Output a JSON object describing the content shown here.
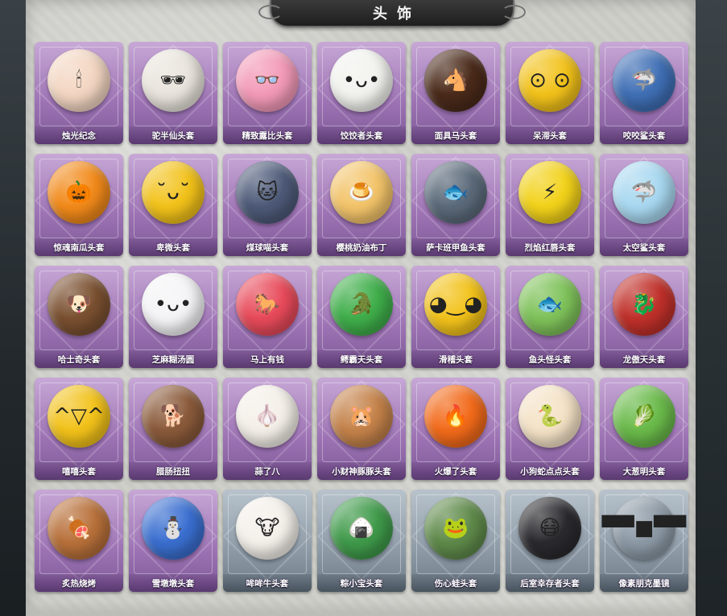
{
  "header": {
    "title": "头饰"
  },
  "items": [
    {
      "label": "烛光纪念",
      "color": "#f3d6c2",
      "glyph": "🕯"
    },
    {
      "label": "驼半仙头套",
      "color": "#e9e4dc",
      "glyph": "🕶"
    },
    {
      "label": "精致露比头套",
      "color": "#f39ab8",
      "glyph": "👓"
    },
    {
      "label": "饺饺者头套",
      "color": "#f2f2ee",
      "glyph": "•ᴗ•"
    },
    {
      "label": "面具马头套",
      "color": "#4a2a1a",
      "glyph": "🐴"
    },
    {
      "label": "呆滞头套",
      "color": "#f2c21a",
      "glyph": "⊙ ⊙"
    },
    {
      "label": "咬咬鲨头套",
      "color": "#3f6fb5",
      "glyph": "🦈"
    },
    {
      "label": "惊魂南瓜头套",
      "color": "#f28a1a",
      "glyph": "🎃"
    },
    {
      "label": "卑微头套",
      "color": "#f2c21a",
      "glyph": "˘ᴗ˘"
    },
    {
      "label": "煤球喵头套",
      "color": "#4d5a78",
      "glyph": "🐱"
    },
    {
      "label": "樱桃奶油布丁",
      "color": "#f3c46a",
      "glyph": "🍮"
    },
    {
      "label": "萨卡班甲鱼头套",
      "color": "#5b6a7a",
      "glyph": "🐟"
    },
    {
      "label": "烈焰红唇头套",
      "color": "#f2d21a",
      "glyph": "⚡"
    },
    {
      "label": "太空鲨头套",
      "color": "#a8d8f0",
      "glyph": "🦈"
    },
    {
      "label": "哈士奇头套",
      "color": "#7a5030",
      "glyph": "🐶"
    },
    {
      "label": "芝麻糊汤圆",
      "color": "#f4f4f6",
      "glyph": "•ᴗ•"
    },
    {
      "label": "马上有钱",
      "color": "#e84a5a",
      "glyph": "🐎"
    },
    {
      "label": "鳄霸天头套",
      "color": "#3fae4a",
      "glyph": "🐊"
    },
    {
      "label": "滑稽头套",
      "color": "#f2c21a",
      "glyph": "◕‿◕"
    },
    {
      "label": "鱼头怪头套",
      "color": "#7fc25a",
      "glyph": "🐟"
    },
    {
      "label": "龙傲天头套",
      "color": "#c0302a",
      "glyph": "🐉"
    },
    {
      "label": "嘻嘻头套",
      "color": "#f2c21a",
      "glyph": "^▽^"
    },
    {
      "label": "腊肠扭扭",
      "color": "#8a5a3a",
      "glyph": "🐕"
    },
    {
      "label": "蒜了八",
      "color": "#f4efe8",
      "glyph": "🧄"
    },
    {
      "label": "小财神豚豚头套",
      "color": "#c4824a",
      "glyph": "🐹"
    },
    {
      "label": "火爆了头套",
      "color": "#f26a1a",
      "glyph": "🔥"
    },
    {
      "label": "小狗蛇点点头套",
      "color": "#f4e2c6",
      "glyph": "🐍"
    },
    {
      "label": "大葱明头套",
      "color": "#6aba4a",
      "glyph": "🥬"
    },
    {
      "label": "炙热烧烤",
      "color": "#b8703a",
      "glyph": "🍖"
    },
    {
      "label": "雪墩墩头套",
      "color": "#3a6fd0",
      "glyph": "⛄"
    },
    {
      "label": "哞哞牛头套",
      "color": "#f4f0ea",
      "glyph": "🐮"
    },
    {
      "label": "粽小宝头套",
      "color": "#3f9a4a",
      "glyph": "🍙"
    },
    {
      "label": "伤心蛙头套",
      "color": "#5f8a4a",
      "glyph": "🐸"
    },
    {
      "label": "后室幸存者头套",
      "color": "#2a2a2e",
      "glyph": "😷"
    },
    {
      "label": "像素朋克墨镜",
      "color": "#8d9aa6",
      "glyph": "▀▀■▀▀"
    }
  ]
}
